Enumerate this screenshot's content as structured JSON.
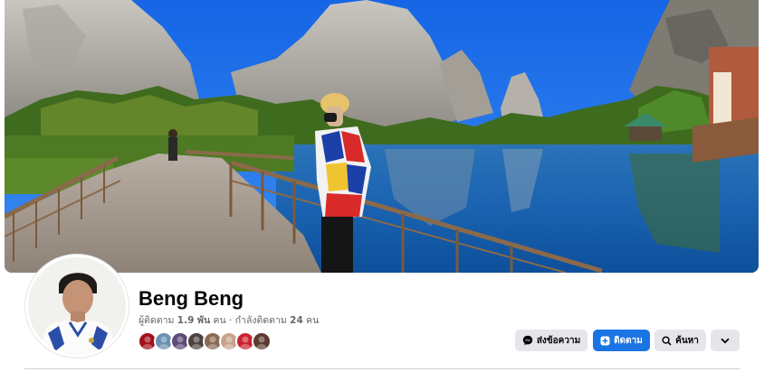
{
  "profile": {
    "name": "Beng Beng",
    "followers_label": "ผู้ติดตาม",
    "followers_count": "1.9 พัน",
    "followers_unit": "คน",
    "separator": "·",
    "following_label": "กำลังติดตาม",
    "following_count": "24",
    "following_unit": "คน"
  },
  "friends": [
    {
      "name": "friend-avatar",
      "color": "#a0101a"
    },
    {
      "name": "friend-avatar",
      "color": "#6a8fb3"
    },
    {
      "name": "friend-avatar",
      "color": "#5b4a7a"
    },
    {
      "name": "friend-avatar",
      "color": "#4c4240"
    },
    {
      "name": "friend-avatar",
      "color": "#8a6b52"
    },
    {
      "name": "friend-avatar",
      "color": "#c7a28a"
    },
    {
      "name": "friend-avatar",
      "color": "#c8242f"
    },
    {
      "name": "friend-avatar",
      "color": "#5a3a2e"
    }
  ],
  "actions": {
    "message_label": "ส่งข้อความ",
    "message_icon": "messenger-icon",
    "follow_label": "ติดตาม",
    "follow_icon": "follow-plus-icon",
    "search_label": "ค้นหา",
    "search_icon": "search-icon",
    "more_icon": "chevron-down-icon"
  },
  "colors": {
    "primary_blue": "#1b74e4",
    "button_gray": "#e4e6eb",
    "secondary_text": "#65676b"
  }
}
